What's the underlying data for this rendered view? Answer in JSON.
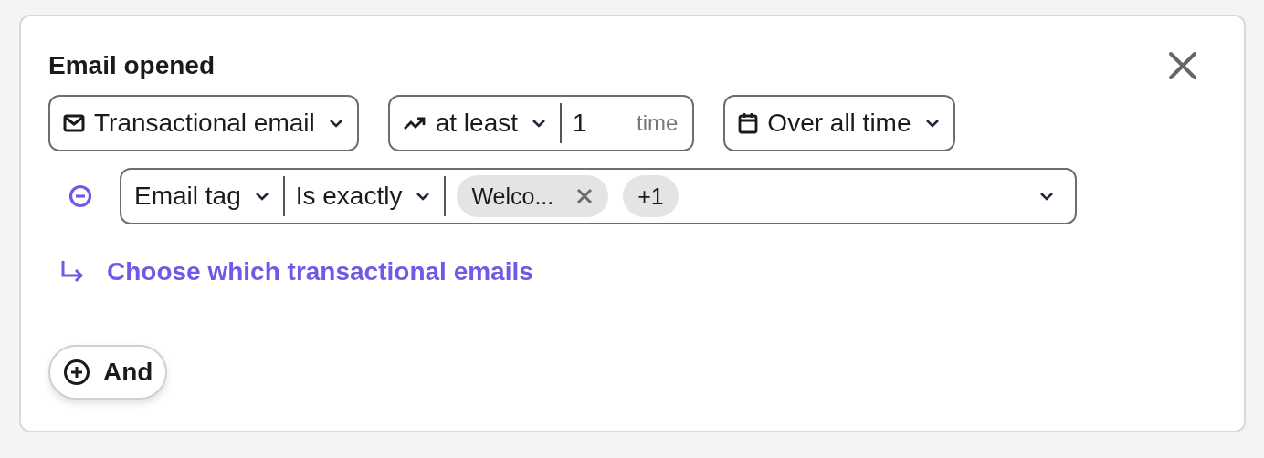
{
  "title": "Email opened",
  "email_type": {
    "label": "Transactional email"
  },
  "frequency": {
    "operator": "at least",
    "count": "1",
    "unit": "time"
  },
  "period": {
    "label": "Over all time"
  },
  "filter": {
    "property": "Email tag",
    "operator": "Is exactly",
    "tags": [
      {
        "label": "Welco...",
        "kind": "removable"
      },
      {
        "label": "+1",
        "kind": "count"
      }
    ]
  },
  "link": "Choose which transactional emails",
  "add_button": "And"
}
